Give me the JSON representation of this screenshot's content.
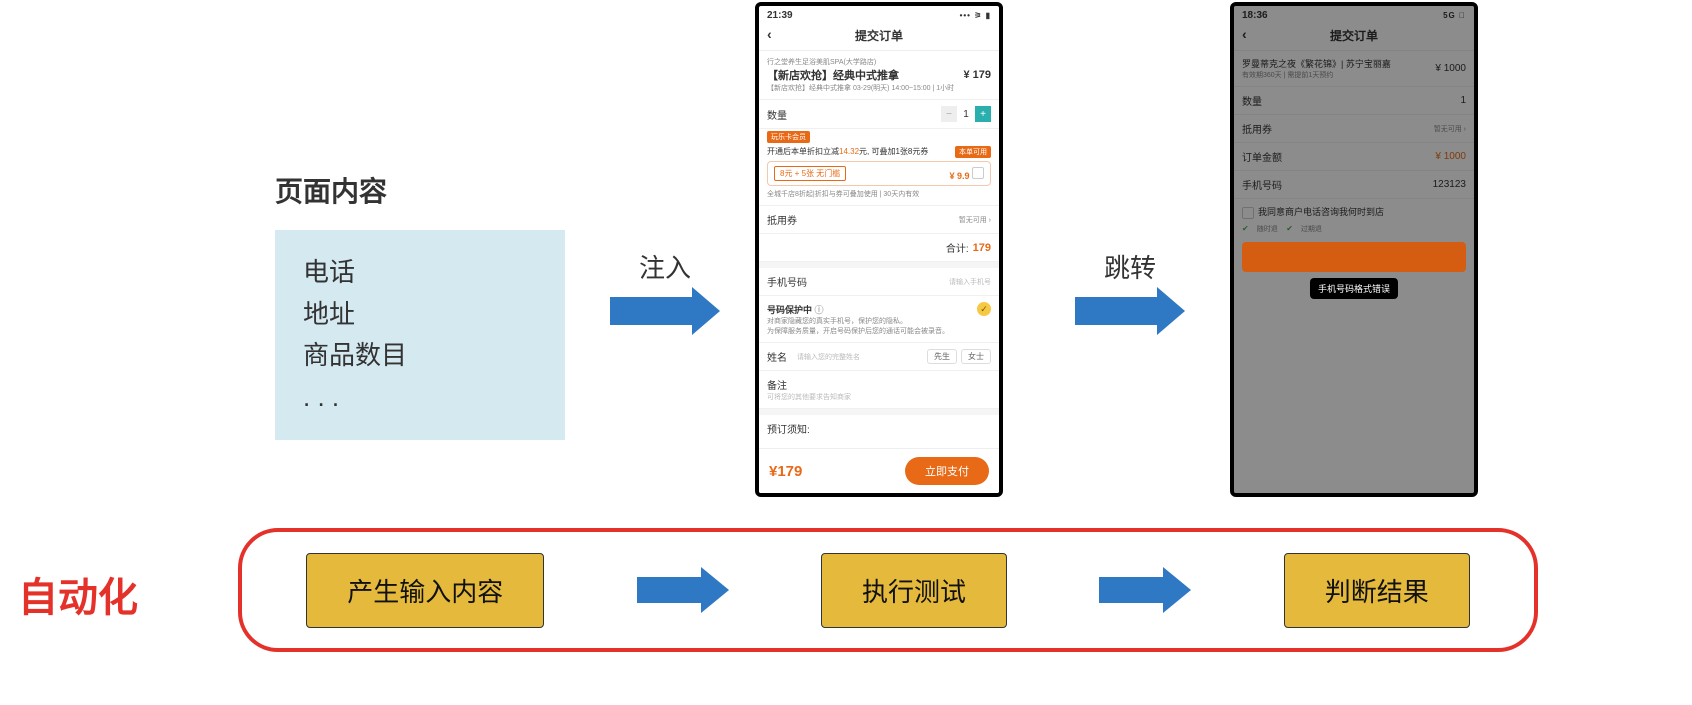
{
  "page_content": {
    "title": "页面内容",
    "items": [
      "电话",
      "地址",
      "商品数目",
      ". . ."
    ]
  },
  "arrows": {
    "inject": "注入",
    "navigate": "跳转"
  },
  "phone1": {
    "time": "21:39",
    "signal": "􀙇 􀛨",
    "nav_title": "提交订单",
    "shop": "行之堂养生足浴美肌SPA(大学路店)",
    "product": "【新店欢抢】经典中式推拿",
    "product_sub": "【新店欢抢】经典中式推拿  03-29(明天) 14:00~15:00 | 1小时",
    "price": "¥ 179",
    "qty_label": "数量",
    "qty_value": "1",
    "member_tag": "玩乐卡会员",
    "promo_line_a": "开通后本单折扣立减",
    "promo_line_amount": "14.32",
    "promo_line_b": "元, 可叠加1张8元券",
    "promo_left": "8元 + 5张  无门槛",
    "promo_right": "¥ 9.9",
    "promo_note": "全城千店8折起|折扣与券可叠加使用 | 30天内有效",
    "coupon_label": "抵用券",
    "coupon_value": "暂无可用",
    "total_label": "合计:",
    "total_value": "179",
    "phone_label": "手机号码",
    "phone_placeholder": "请输入手机号",
    "protect_title": "号码保护中",
    "protect_l1": "对商家隐藏您的真实手机号，保护您的隐私。",
    "protect_l2": "为保障服务质量，开启号码保护后您的通话可能会被录音。",
    "name_label": "姓名",
    "name_placeholder": "请输入您的完整姓名",
    "pill_m": "先生",
    "pill_f": "女士",
    "remark_label": "备注",
    "remark_placeholder": "可将您的其他要求告知商家",
    "notice_label": "预订须知:",
    "foot_price": "¥179",
    "pay_button": "立即支付"
  },
  "phone2": {
    "time": "18:36",
    "signal": "5G 􀛨",
    "nav_title": "提交订单",
    "product": "罗曼蒂克之夜《繁花锦》| 苏宁宝丽嘉",
    "product_sub": "有效期360天 | 需提前1天预约",
    "price": "¥ 1000",
    "qty_label": "数量",
    "qty_value": "1",
    "coupon_label": "抵用券",
    "coupon_value": "暂无可用",
    "amount_label": "订单金额",
    "amount_value": "¥ 1000",
    "phone_label": "手机号码",
    "phone_value": "123123",
    "consent": "我同意商户电话咨询我何时到店",
    "ship1": "随时退",
    "ship2": "过期退",
    "toast": "手机号码格式错误"
  },
  "bottom": {
    "automation": "自动化",
    "step1": "产生输入内容",
    "step2": "执行测试",
    "step3": "判断结果"
  }
}
